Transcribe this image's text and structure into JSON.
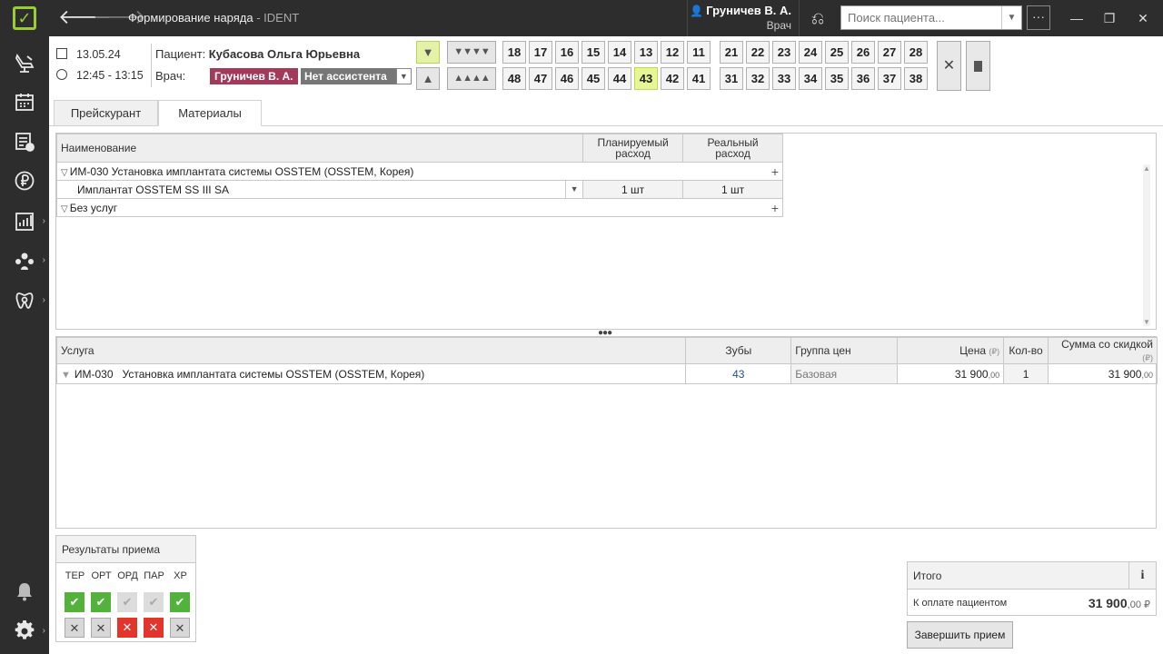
{
  "window": {
    "title": "Формирование наряда",
    "app": " - IDENT",
    "user_name": "Груничев В. А.",
    "user_role": "Врач",
    "search_placeholder": "Поиск пациента..."
  },
  "visit": {
    "date": "13.05.24",
    "time": "12:45 - 13:15",
    "patient_label": "Пациент:",
    "patient_name": "Кубасова Ольга Юрьевна",
    "doctor_label": "Врач:",
    "doctor_name": "Груничев В. А.",
    "assistant": "Нет ассистента"
  },
  "teeth": {
    "upper": [
      "18",
      "17",
      "16",
      "15",
      "14",
      "13",
      "12",
      "11",
      "21",
      "22",
      "23",
      "24",
      "25",
      "26",
      "27",
      "28"
    ],
    "lower": [
      "48",
      "47",
      "46",
      "45",
      "44",
      "43",
      "42",
      "41",
      "31",
      "32",
      "33",
      "34",
      "35",
      "36",
      "37",
      "38"
    ],
    "selected": "43"
  },
  "tabs": [
    {
      "label": "Прейскурант"
    },
    {
      "label": "Материалы"
    }
  ],
  "materials": {
    "headers": {
      "name": "Наименование",
      "planned": "Планируемый расход",
      "planned_l1": "Планируемый",
      "planned_l2": "расход",
      "real_l1": "Реальный",
      "real_l2": "расход"
    },
    "group1": "ИМ-030 Установка имплантата системы OSSTEM (OSSTEM, Корея)",
    "item1": {
      "name": "Имплантат OSSTEM SS III SA",
      "planned": "1 шт",
      "real": "1 шт"
    },
    "group2": "Без услуг"
  },
  "services": {
    "headers": {
      "service": "Услуга",
      "teeth": "Зубы",
      "price_group": "Группа цен",
      "price": "Цена",
      "qty": "Кол-во",
      "sum": "Сумма со скидкой",
      "currency": "(₽)"
    },
    "rows": [
      {
        "code": "ИМ-030",
        "name": "Установка имплантата системы OSSTEM (OSSTEM, Корея)",
        "teeth": "43",
        "price_group": "Базовая",
        "price": "31 900",
        "price_cents": ",00",
        "qty": "1",
        "sum": "31 900",
        "sum_cents": ",00"
      }
    ]
  },
  "results": {
    "title": "Результаты приема",
    "columns": [
      "ТЕР",
      "ОРТ",
      "ОРД",
      "ПАР",
      "ХР"
    ]
  },
  "total": {
    "title": "Итого",
    "info": "i",
    "pay_label": "К оплате пациентом",
    "pay_value": "31 900",
    "pay_cents": ",00 ₽"
  },
  "finish_label": "Завершить прием",
  "colors": {
    "sidebar": "#2d2d2d",
    "accent_green": "#9acd32",
    "doctor_chip": "#a33a5a",
    "ok": "#52b23c",
    "cancel_red": "#e2352b",
    "tooth_selected": "#e6f598"
  }
}
